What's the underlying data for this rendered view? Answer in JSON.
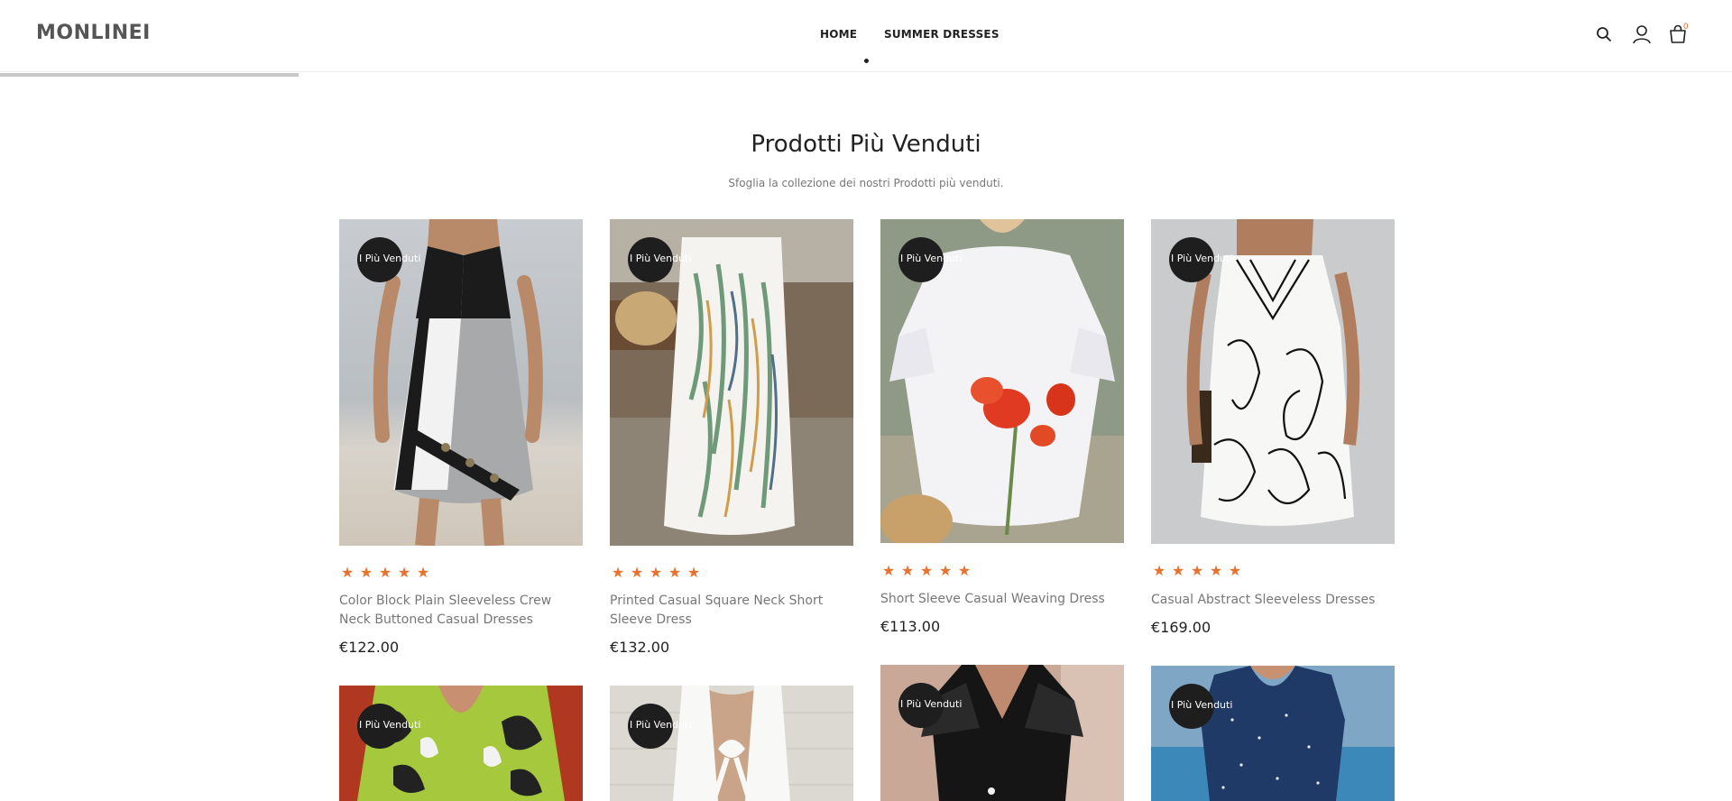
{
  "header": {
    "logo": "MONLINEI",
    "nav": [
      {
        "label": "HOME"
      },
      {
        "label": "SUMMER DRESSES"
      }
    ],
    "cart_count": "0",
    "icons": {
      "search": "search-icon",
      "account": "user-icon",
      "cart": "cart-icon"
    }
  },
  "section": {
    "title": "Prodotti Più Venduti",
    "subtitle": "Sfoglia la collezione dei nostri Prodotti più venduti."
  },
  "badge_label": "I Più Venduti",
  "rating_stars": 5,
  "colors": {
    "accent": "#e8712e",
    "badge": "#1e1e1e",
    "text": "#222222",
    "muted": "#777777"
  },
  "products": [
    {
      "name": "Color Block Plain Sleeveless Crew Neck Buttoned Casual Dresses",
      "price": "€122.00",
      "badge": "I Più Venduti"
    },
    {
      "name": "Printed Casual Square Neck Short Sleeve Dress",
      "price": "€132.00",
      "badge": "I Più Venduti"
    },
    {
      "name": "Short Sleeve Casual Weaving Dress",
      "price": "€113.00",
      "badge": "I Più Venduti"
    },
    {
      "name": "Casual Abstract Sleeveless Dresses",
      "price": "€169.00",
      "badge": "I Più Venduti"
    },
    {
      "badge": "I Più Venduti"
    },
    {
      "badge": "I Più Venduti"
    },
    {
      "badge": "I Più Venduti"
    },
    {
      "badge": "I Più Venduti"
    }
  ]
}
